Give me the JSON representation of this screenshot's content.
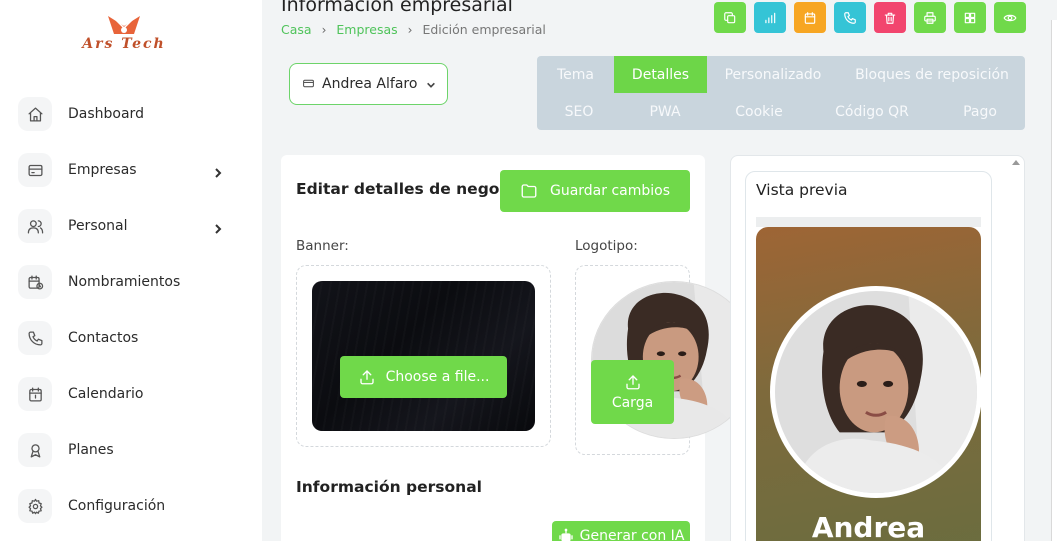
{
  "brand": {
    "logo_text": "Ars Tech"
  },
  "sidebar": {
    "items": [
      {
        "label": "Dashboard",
        "icon": "home-icon",
        "has_submenu": false
      },
      {
        "label": "Empresas",
        "icon": "card-icon",
        "has_submenu": true
      },
      {
        "label": "Personal",
        "icon": "users-icon",
        "has_submenu": true
      },
      {
        "label": "Nombramientos",
        "icon": "calendar-clock-icon",
        "has_submenu": false
      },
      {
        "label": "Contactos",
        "icon": "phone-icon",
        "has_submenu": false
      },
      {
        "label": "Calendario",
        "icon": "calendar-icon",
        "has_submenu": false
      },
      {
        "label": "Planes",
        "icon": "award-icon",
        "has_submenu": false
      },
      {
        "label": "Configuración",
        "icon": "gear-icon",
        "has_submenu": false
      }
    ]
  },
  "header": {
    "title": "Información empresarial",
    "breadcrumb": [
      "Casa",
      "Empresas",
      "Edición empresarial"
    ],
    "toolbar_buttons": [
      {
        "icon": "copy-icon",
        "color": "#70d94a"
      },
      {
        "icon": "chart-icon",
        "color": "#35c4d6"
      },
      {
        "icon": "calendar-icon",
        "color": "#f7a623"
      },
      {
        "icon": "phone-icon",
        "color": "#35c4d6"
      },
      {
        "icon": "trash-icon",
        "color": "#f2456e"
      },
      {
        "icon": "print-icon",
        "color": "#70d94a"
      },
      {
        "icon": "grid-icon",
        "color": "#70d94a"
      },
      {
        "icon": "eye-icon",
        "color": "#70d94a"
      }
    ]
  },
  "user_select": {
    "value": "Andrea Alfaro"
  },
  "tabs": {
    "row1": [
      "Tema",
      "Detalles",
      "Personalizado",
      "Bloques de reposición"
    ],
    "row2": [
      "SEO",
      "PWA",
      "Cookie",
      "Código QR",
      "Pago"
    ],
    "active": "Detalles"
  },
  "edit_form": {
    "title": "Editar detalles de negocio:",
    "save_label": "Guardar cambios",
    "banner_label": "Banner:",
    "logo_label": "Logotipo:",
    "choose_file_label": "Choose a file...",
    "upload_label": "Carga",
    "personal_section_title": "Información personal",
    "ai_button_label": "Generar con IA"
  },
  "preview": {
    "title": "Vista previa",
    "name": "Andrea"
  },
  "colors": {
    "accent": "#70d94a",
    "tabs_bg": "#c9d5dd"
  }
}
